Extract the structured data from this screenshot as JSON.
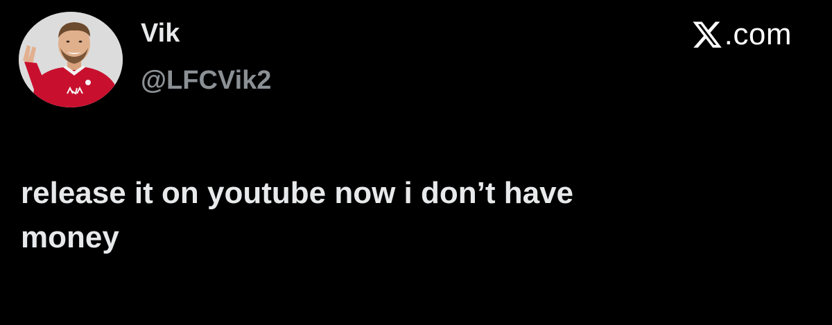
{
  "tweet": {
    "author": {
      "name": "Vik",
      "handle": "@LFCVik2",
      "avatar_icon": "avatar-photo-red-jersey",
      "avatar_jersey_color": "#c8102e"
    },
    "source": {
      "icon": "x-logo-icon",
      "domain": ".com"
    },
    "text": "release it on youtube now i don’t have\nmoney"
  },
  "theme": {
    "background": "#000000",
    "text_primary": "#e7e9ea",
    "text_secondary": "#8b9095"
  }
}
